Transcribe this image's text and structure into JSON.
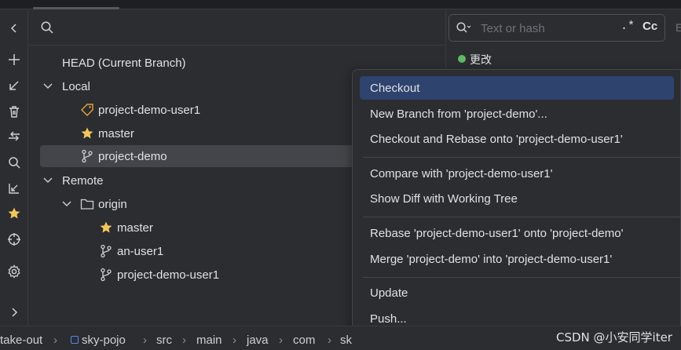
{
  "branches_panel": {
    "head_label": "HEAD (Current Branch)",
    "local": {
      "label": "Local",
      "items": [
        "project-demo-user1",
        "master",
        "project-demo"
      ]
    },
    "remote": {
      "label": "Remote",
      "origin_label": "origin",
      "items": [
        "master",
        "an-user1",
        "project-demo-user1"
      ]
    }
  },
  "log_panel": {
    "search_placeholder": "Text or hash",
    "regex_label": ".*",
    "case_label": "Cc",
    "cut_label": "E",
    "commit_label": "更改"
  },
  "context_menu": {
    "groups": [
      [
        "Checkout",
        "New Branch from 'project-demo'...",
        "Checkout and Rebase onto 'project-demo-user1'"
      ],
      [
        "Compare with 'project-demo-user1'",
        "Show Diff with Working Tree"
      ],
      [
        "Rebase 'project-demo-user1' onto 'project-demo'",
        "Merge 'project-demo' into 'project-demo-user1'"
      ],
      [
        "Update",
        "Push..."
      ]
    ],
    "active_item": "Checkout"
  },
  "status_bar": {
    "breadcrumbs": [
      "take-out",
      "sky-pojo",
      "src",
      "main",
      "java",
      "com",
      "sk"
    ]
  },
  "watermark": "CSDN @小安同学iter",
  "colors": {
    "background": "#2b2d30",
    "selection": "#43454a",
    "menu_active": "#2e436e",
    "star": "#f2c55c",
    "commit_dot": "#5fb865"
  }
}
